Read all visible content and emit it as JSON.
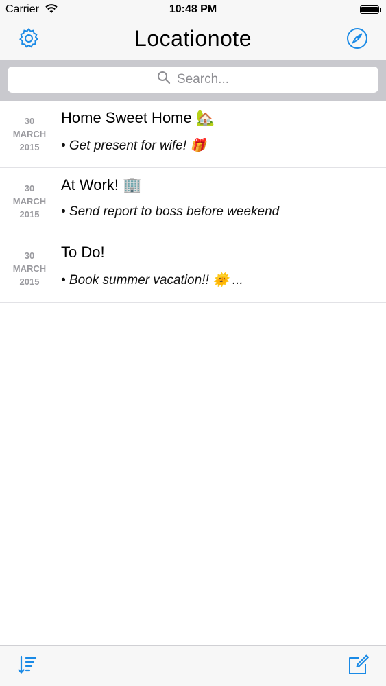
{
  "status_bar": {
    "carrier": "Carrier",
    "time": "10:48 PM",
    "battery_level": 1.0,
    "icons": [
      "wifi-icon",
      "battery-icon"
    ]
  },
  "nav": {
    "title": "Locationote",
    "left_icon": "gear-icon",
    "right_icon": "compass-icon"
  },
  "search": {
    "placeholder": "Search...",
    "icon": "magnifier-icon"
  },
  "notes": [
    {
      "day": "30",
      "month": "MARCH",
      "year": "2015",
      "title": "Home Sweet Home 🏡",
      "snippet": "• Get present for wife! 🎁"
    },
    {
      "day": "30",
      "month": "MARCH",
      "year": "2015",
      "title": "At Work! 🏢",
      "snippet": "• Send report to boss before weekend"
    },
    {
      "day": "30",
      "month": "MARCH",
      "year": "2015",
      "title": "To Do!",
      "snippet": "• Book summer vacation!! 🌞 ..."
    }
  ],
  "toolbar": {
    "left_icon": "sort-icon",
    "right_icon": "compose-icon"
  },
  "colors": {
    "accent": "#1a8ae6",
    "search_bar_bg": "#c9c9ce",
    "date_text": "#9a9a9f"
  }
}
